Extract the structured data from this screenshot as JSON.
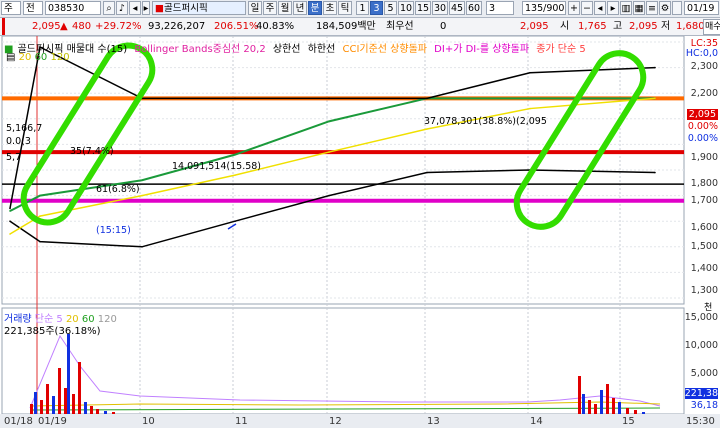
{
  "toolbar": {
    "market": "주",
    "period_mode": "전",
    "code": "038530",
    "name": "골드퍼시픽",
    "periods": [
      "일",
      "주",
      "월",
      "년",
      "분",
      "초",
      "틱"
    ],
    "active_period": "분",
    "intervals": [
      "1",
      "3",
      "5",
      "10",
      "15",
      "30",
      "45",
      "60"
    ],
    "active_interval": "3",
    "multiplier": "3",
    "page": "135/900",
    "date": "01/19"
  },
  "quote": {
    "price": "2,095",
    "change": "480",
    "change_pct": "+29.72%",
    "volume": "93,226,207",
    "vol_ratio": "206.51%",
    "turnover_pct": "40.83%",
    "amount": "184,509백만",
    "pref_label": "최우선",
    "pref_value": "0",
    "ask": "2,095",
    "open_label": "시",
    "open": "1,765",
    "high_label": "고",
    "high": "2,095",
    "low_label": "저",
    "low": "1,680",
    "sell_label": "매수"
  },
  "price_pane": {
    "title": "골드퍼시픽 매물대 수(15)",
    "indicators": [
      "Bollinger Bands중심선 20,2",
      "상한선",
      "하한선",
      "CCI기준선 상향돌파",
      "DI+가 DI-를 상향돌파",
      "종가 단순 5"
    ],
    "ma_periods": [
      "20",
      "60",
      "120"
    ],
    "axis_labels": [
      "2,300",
      "2,200",
      "2,095",
      "2,000",
      "1,900",
      "1,800",
      "1,700",
      "1,600",
      "1,500",
      "1,400",
      "1,300"
    ],
    "axis_top": [
      "LC:35",
      "HC:0,0"
    ],
    "current_price_tag": "2,095",
    "pct_tags": [
      "0.00%",
      "0.00%"
    ],
    "annotations": [
      "37,078,301(38.8%)(2,095",
      "14,091,514(15.58)",
      "5,166,7",
      "5,7",
      "61(6.8%)",
      "(15:15)",
      "0.0(3",
      "35(7.4%)"
    ]
  },
  "volume_pane": {
    "title": "거래량",
    "ma_label": "단순 5",
    "ma_periods": [
      "20",
      "60",
      "120"
    ],
    "value": "221,385주(36.18%)",
    "axis_labels": [
      "15,000",
      "10,000",
      "5,000",
      "221,38",
      "36,18"
    ],
    "unit": "천"
  },
  "x_axis": {
    "labels": [
      "01/18",
      "01/19",
      "10",
      "11",
      "12",
      "13",
      "14",
      "15",
      "15:30"
    ]
  },
  "chart_data": {
    "type": "line",
    "title": "골드퍼시픽 매물대 수(15)",
    "ylim": [
      1300,
      2300
    ],
    "x": [
      "01/18",
      "01/19",
      "10",
      "11",
      "12",
      "13",
      "14",
      "15"
    ],
    "series": [
      {
        "name": "Bollinger Bands중심선 20,2",
        "values": [
          1640,
          1700,
          1760,
          1860,
          1990,
          2080,
          2080,
          2080
        ]
      },
      {
        "name": "상한선",
        "values": [
          1650,
          2280,
          2080,
          2080,
          2080,
          2080,
          2180,
          2200
        ]
      },
      {
        "name": "하한선",
        "values": [
          1600,
          1520,
          1500,
          1600,
          1700,
          1790,
          1800,
          1790
        ]
      },
      {
        "name": "종가 단순 5",
        "values": [
          1550,
          1620,
          1700,
          1780,
          1870,
          1960,
          2040,
          2080
        ]
      }
    ],
    "horizontal_lines": [
      {
        "value": 2080,
        "color": "#ff6a00"
      },
      {
        "value": 1870,
        "color": "#e00000"
      },
      {
        "value": 1745,
        "color": "#000000"
      },
      {
        "value": 1680,
        "color": "#e000c8"
      }
    ],
    "grid": true
  }
}
